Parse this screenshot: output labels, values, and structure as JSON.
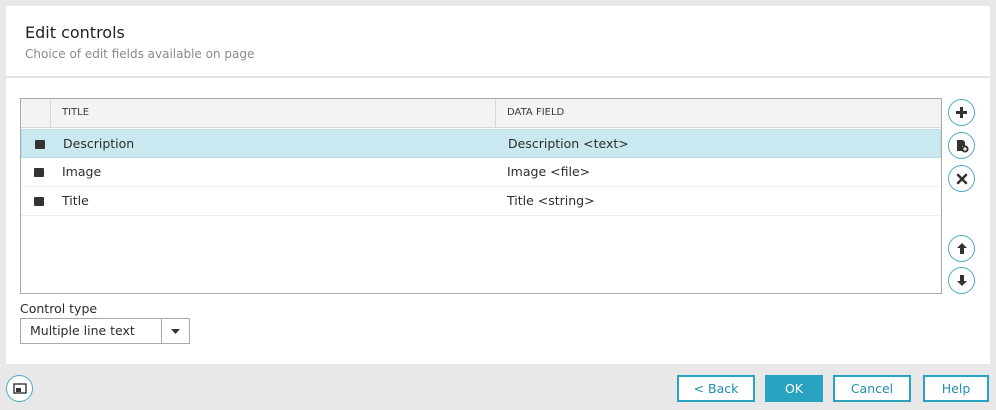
{
  "dialog": {
    "title": "Edit controls",
    "subtitle": "Choice of edit fields available on page"
  },
  "grid": {
    "columns": [
      "TITLE",
      "DATA FIELD"
    ],
    "rows": [
      {
        "title": "Description",
        "field": "Description <text>",
        "selected": true
      },
      {
        "title": "Image",
        "field": "Image <file>",
        "selected": false
      },
      {
        "title": "Title",
        "field": "Title <string>",
        "selected": false
      }
    ]
  },
  "side_buttons": [
    "add-icon",
    "add-from-template-icon",
    "delete-icon",
    "move-up-icon",
    "move-down-icon"
  ],
  "control_type": {
    "label": "Control type",
    "value": "Multiple line text"
  },
  "footer": {
    "back": "< Back",
    "ok": "OK",
    "cancel": "Cancel",
    "help": "Help"
  },
  "colors": {
    "accent": "#2aa3c2",
    "selected_row": "#c9e8f0"
  }
}
